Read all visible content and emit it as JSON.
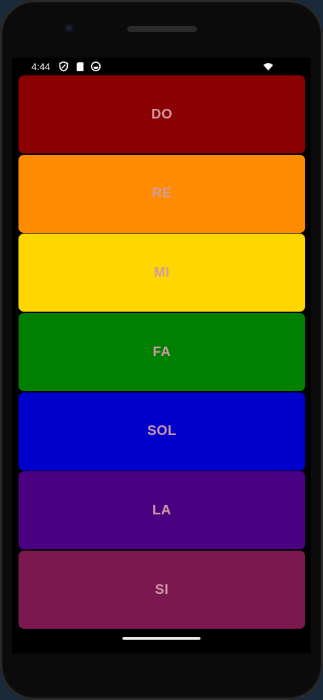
{
  "status_bar": {
    "time": "4:44",
    "icons": [
      "shield-icon",
      "sd-card-icon",
      "vpn-icon",
      "wifi-icon"
    ]
  },
  "tiles": [
    {
      "label": "DO",
      "color": "#8b0000"
    },
    {
      "label": "RE",
      "color": "#ff8c00"
    },
    {
      "label": "MI",
      "color": "#ffd700"
    },
    {
      "label": "FA",
      "color": "#008000"
    },
    {
      "label": "SOL",
      "color": "#0000cd"
    },
    {
      "label": "LA",
      "color": "#4b0082"
    },
    {
      "label": "SI",
      "color": "#7b1850"
    }
  ],
  "label_color": "#d29aa5"
}
